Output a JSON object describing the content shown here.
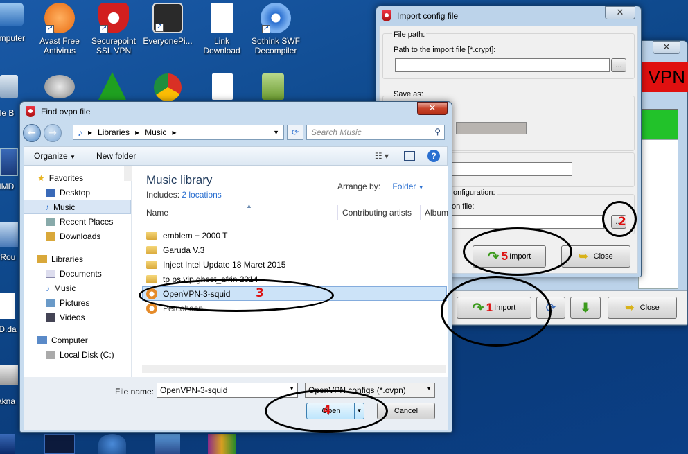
{
  "desktop": {
    "icons": [
      {
        "label": "omputer",
        "color": "#5a9ad8"
      },
      {
        "label": "Avast Free\nAntivirus",
        "color": "#f07a1a"
      },
      {
        "label": "Securepoint\nSSL VPN",
        "color": "#c81e1e"
      },
      {
        "label": "EveryonePi...",
        "color": "#333333"
      },
      {
        "label": "Link\nDownload",
        "color": "#ffffff"
      },
      {
        "label": "Sothink SWF\nDecompiler",
        "color": "#2a6fd0"
      }
    ],
    "left_labels": [
      "ycle B",
      "MMD",
      "erRou",
      "MD.da",
      "Jakna"
    ]
  },
  "import_dialog": {
    "title": "Import config file",
    "file_path_group": "File path:",
    "path_label": "Path to the import file [*.crypt]:",
    "browse": "...",
    "save_as_group": "Save as:",
    "config_partial": "onfiguration:",
    "file_partial": "on file:",
    "import_button": "Import",
    "close_button": "Close"
  },
  "main_window": {
    "vpn_banner": "VPN",
    "import_button": "Import",
    "close_button": "Close"
  },
  "file_dialog": {
    "title": "Find ovpn file",
    "breadcrumb": [
      "Libraries",
      "Music"
    ],
    "search_placeholder": "Search Music",
    "organize": "Organize",
    "new_folder": "New folder",
    "nav": {
      "favorites": "Favorites",
      "favorites_items": [
        "Desktop",
        "Music",
        "Recent Places",
        "Downloads"
      ],
      "libraries": "Libraries",
      "library_items": [
        "Documents",
        "Music",
        "Pictures",
        "Videos"
      ],
      "computer": "Computer",
      "computer_items": [
        "Local Disk (C:)"
      ]
    },
    "library_title": "Music library",
    "includes_label": "Includes:",
    "includes_link": "2 locations",
    "arrange_label": "Arrange by:",
    "arrange_value": "Folder",
    "columns": [
      "Name",
      "Contributing artists",
      "Album"
    ],
    "files": [
      {
        "name": "emblem + 2000 T",
        "type": "folder"
      },
      {
        "name": "Garuda V.3",
        "type": "folder"
      },
      {
        "name": "Inject Intel Update 18 Maret 2015",
        "type": "folder"
      },
      {
        "name": "tp ps vip ghost_afrin 2014",
        "type": "folder"
      },
      {
        "name": "OpenVPN-3-squid",
        "type": "ovpn",
        "selected": true
      },
      {
        "name": "Percobaan",
        "type": "ovpn"
      }
    ],
    "file_name_label": "File name:",
    "file_name_value": "OpenVPN-3-squid",
    "filter": "OpenVPN configs (*.ovpn)",
    "open_button": "Open",
    "cancel_button": "Cancel"
  },
  "annotations": [
    "1",
    "2",
    "3",
    "4",
    "5"
  ],
  "colors": {
    "accent_green": "#22c22a",
    "vpn_red": "#e01010",
    "annotation_red": "#dd1111"
  }
}
